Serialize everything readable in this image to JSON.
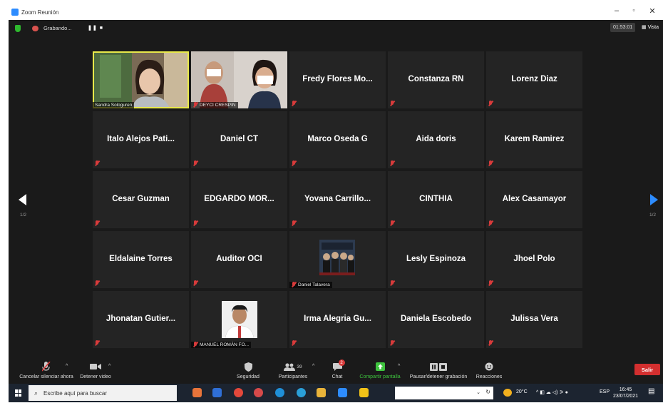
{
  "window": {
    "title": "Zoom Reunión",
    "controls": [
      "–",
      "▫",
      "✕"
    ]
  },
  "recording": {
    "status": "Grabando...",
    "pause_icon": "pause-icon",
    "stop_icon": "stop-icon"
  },
  "timer": "01:53:01",
  "view_label": "Vista",
  "pagination": {
    "left": "1/2",
    "right": "1/2"
  },
  "participants": [
    {
      "name": "Sandra Sologuren",
      "kind": "video"
    },
    {
      "name": "DEYCI CRESPIN",
      "kind": "video"
    },
    {
      "name": "Fredy Flores Mo...",
      "kind": "name"
    },
    {
      "name": "Constanza RN",
      "kind": "name"
    },
    {
      "name": "Lorenz Diaz",
      "kind": "name"
    },
    {
      "name": "Italo Alejos Pati...",
      "kind": "name"
    },
    {
      "name": "Daniel CT",
      "kind": "name"
    },
    {
      "name": "Marco Oseda G",
      "kind": "name"
    },
    {
      "name": "Aida doris",
      "kind": "name"
    },
    {
      "name": "Karem Ramirez",
      "kind": "name"
    },
    {
      "name": "Cesar Guzman",
      "kind": "name"
    },
    {
      "name": "EDGARDO MOR...",
      "kind": "name"
    },
    {
      "name": "Yovana Carrillo...",
      "kind": "name"
    },
    {
      "name": "CINTHIA",
      "kind": "name"
    },
    {
      "name": "Alex Casamayor",
      "kind": "name"
    },
    {
      "name": "Eldalaine Torres",
      "kind": "name"
    },
    {
      "name": "Auditor OCI",
      "kind": "name"
    },
    {
      "name": "Daniel Talavera",
      "kind": "photo"
    },
    {
      "name": "Lesly Espinoza",
      "kind": "name"
    },
    {
      "name": "Jhoel Polo",
      "kind": "name"
    },
    {
      "name": "Jhonatan Gutier...",
      "kind": "name"
    },
    {
      "name": "MANUEL ROMÁN FO...",
      "kind": "photo"
    },
    {
      "name": "Irma Alegria Gu...",
      "kind": "name"
    },
    {
      "name": "Daniela Escobedo",
      "kind": "name"
    },
    {
      "name": "Julissa Vera",
      "kind": "name"
    }
  ],
  "toolbar": {
    "mute": "Cancelar silenciar ahora",
    "video": "Detener video",
    "security": "Seguridad",
    "participants": "Participantes",
    "participants_count": "39",
    "chat": "Chat",
    "chat_badge": "2",
    "share": "Compartir pantalla",
    "record": "Pausar/detener grabación",
    "reactions": "Reacciones",
    "leave": "Salir"
  },
  "taskbar": {
    "search_placeholder": "Escribe aquí para buscar",
    "temperature": "20°C",
    "language": "ESP",
    "time": "16:45",
    "date": "23/07/2021"
  },
  "colors": {
    "zoom_blue": "#2d8cff",
    "share_green": "#3ec43e",
    "leave_red": "#d32f2f",
    "active_speaker": "#e8e84a",
    "muted_red": "#d93b3b"
  }
}
